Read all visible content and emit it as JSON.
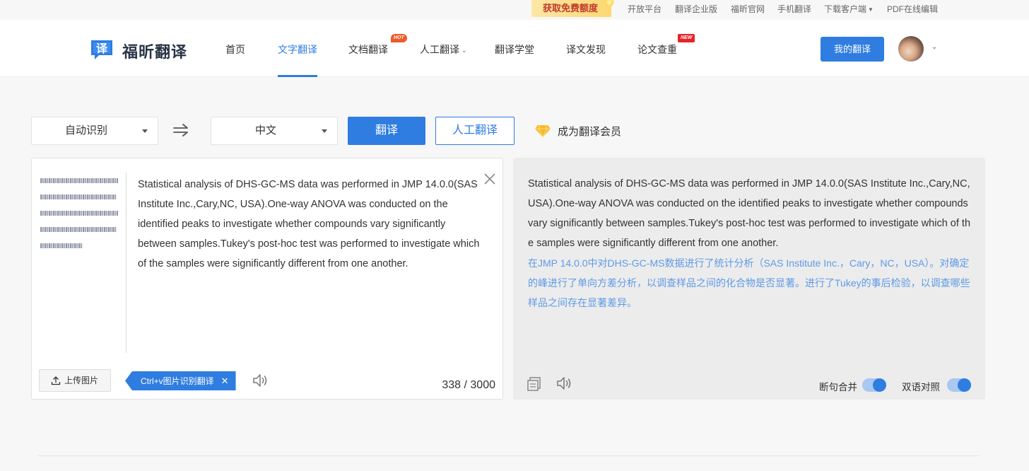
{
  "top_bar": {
    "promo": "获取免费额度",
    "links": [
      {
        "label": "开放平台",
        "has_caret": false
      },
      {
        "label": "翻译企业版",
        "has_caret": false
      },
      {
        "label": "福昕官网",
        "has_caret": false
      },
      {
        "label": "手机翻译",
        "has_caret": false
      },
      {
        "label": "下载客户端",
        "has_caret": true
      },
      {
        "label": "PDF在线编辑",
        "has_caret": false
      }
    ]
  },
  "header": {
    "logo_glyph": "译",
    "logo_text": "福昕翻译",
    "nav": [
      {
        "label": "首页",
        "active": false
      },
      {
        "label": "文字翻译",
        "active": true
      },
      {
        "label": "文档翻译",
        "badge": "HOT"
      },
      {
        "label": "人工翻译",
        "has_caret": true
      },
      {
        "label": "翻译学堂"
      },
      {
        "label": "译文发现"
      },
      {
        "label": "论文查重",
        "badge": "NEW"
      }
    ],
    "my_translation": "我的翻译"
  },
  "controls": {
    "source_lang": "自动识别",
    "target_lang": "中文",
    "translate": "翻译",
    "human_translate": "人工翻译",
    "vip": "成为翻译会员"
  },
  "source": {
    "text": "Statistical analysis of DHS-GC-MS data was performed in JMP 14.0.0(SAS Institute Inc.,Cary,NC, USA).One-way ANOVA was conducted on the identified peaks to investigate whether compounds vary significantly between samples.Tukey's post-hoc test was performed to investigate which of the samples were significantly different from one another.",
    "upload": "上传图片",
    "ctrlv_tip": "Ctrl+v图片识别翻译",
    "count": "338 / 3000"
  },
  "target": {
    "original": "Statistical analysis of DHS-GC-MS data was performed in JMP 14.0.0(SAS Institute Inc.,Cary,NC, USA).One-way ANOVA was conducted on the identified peaks to investigate whether compounds vary significantly between samples.Tukey's post-hoc test was performed to investigate which of the samples were significantly different from one another.",
    "translation": "在JMP 14.0.0中对DHS-GC-MS数据进行了统计分析（SAS Institute Inc.，Cary，NC，USA）。对确定的峰进行了单向方差分析，以调查样品之间的化合物是否显著。进行了Tukey的事后检验，以调查哪些样品之间存在显著差异。",
    "toggle1": "断句合并",
    "toggle2": "双语对照",
    "toggle1_on": true,
    "toggle2_on": true
  },
  "colors": {
    "accent": "#2f7de1",
    "translation_text": "#5f9ae6",
    "promo_bg": "#fcd873"
  }
}
